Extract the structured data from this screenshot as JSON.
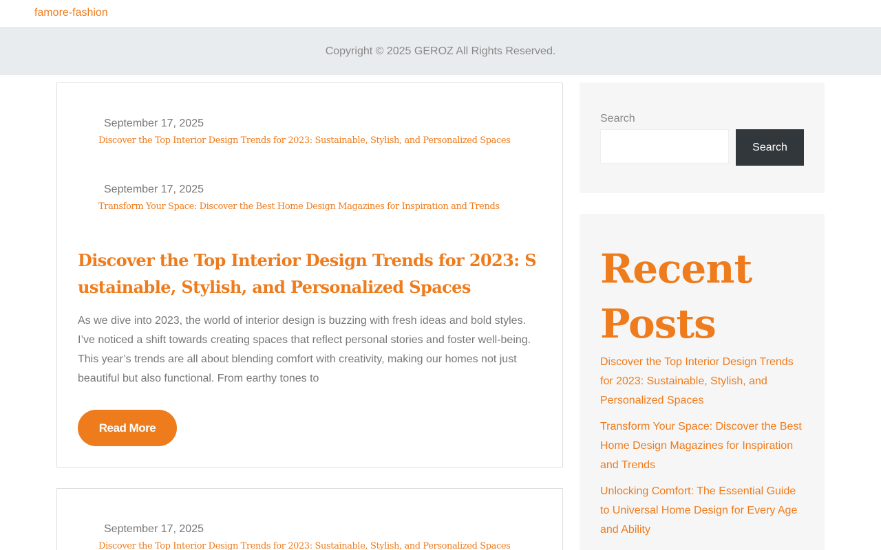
{
  "site": {
    "title": "famore-fashion"
  },
  "footer": {
    "copyright": "Copyright © 2025 GEROZ All Rights Reserved."
  },
  "main": {
    "post": {
      "related": [
        {
          "date": "September 17, 2025",
          "title": "Discover the Top Interior Design Trends for 2023: Sustainable, Stylish, and Personalized Spaces"
        },
        {
          "date": "September 17, 2025",
          "title": "Transform Your Space: Discover the Best Home Design Magazines for Inspiration and Trends"
        }
      ],
      "title": "Discover the Top Interior Design Trends for 2023: Sustainable, Stylish, and Personalized Spaces",
      "excerpt": "As we dive into 2023, the world of interior design is buzzing with fresh ideas and bold styles. I’ve noticed a shift towards creating spaces that reflect personal stories and foster well-being. This year’s trends are all about blending comfort with creativity, making our homes not just beautiful but also functional. From earthy tones to",
      "read_more": "Read More"
    },
    "post2": {
      "related": [
        {
          "date": "September 17, 2025",
          "title": "Discover the Top Interior Design Trends for 2023: Sustainable, Stylish, and Personalized Spaces"
        }
      ]
    }
  },
  "sidebar": {
    "search": {
      "label": "Search",
      "button": "Search",
      "value": ""
    },
    "recent": {
      "title": "Recent Posts",
      "items": [
        "Discover the Top Interior Design Trends for 2023: Sustainable, Stylish, and Personalized Spaces",
        "Transform Your Space: Discover the Best Home Design Magazines for Inspiration and Trends",
        "Unlocking Comfort: The Essential Guide to Universal Home Design for Every Age and Ability"
      ]
    }
  },
  "colors": {
    "accent": "#ee7b1c",
    "button_dark": "#32373c",
    "footer_bg": "#e9ecef",
    "widget_bg": "#f6f6f6"
  }
}
